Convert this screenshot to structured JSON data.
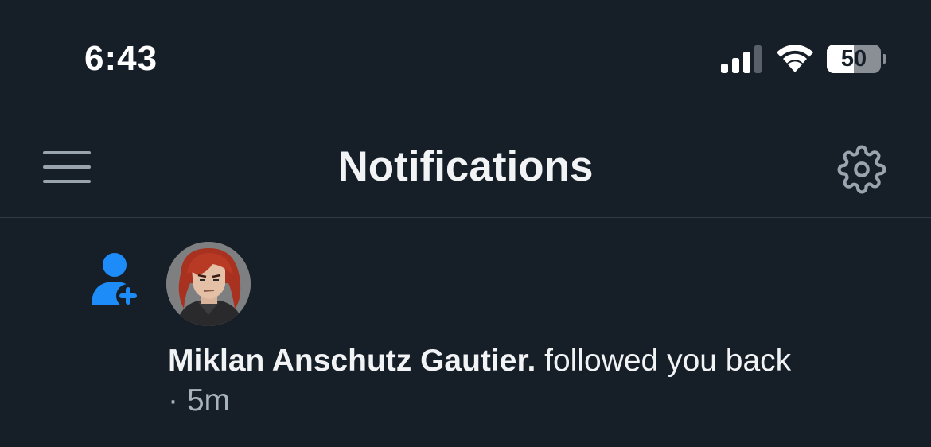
{
  "status_bar": {
    "time": "6:43",
    "battery_level": "50",
    "battery_fraction": 0.5,
    "signal_bars": 3,
    "signal_bars_total": 4
  },
  "header": {
    "title": "Notifications",
    "menu_icon": "hamburger-menu-icon",
    "settings_icon": "gear-icon"
  },
  "notifications": [
    {
      "type_icon": "person-add-icon",
      "avatar": "red-haired-character-avatar",
      "name": "Miklan Anschutz Gautier.",
      "action": " followed you back",
      "time": "· 5m"
    }
  ],
  "colors": {
    "background": "#161e27",
    "accent": "#1d8cf8",
    "text": "#f1f3f5",
    "muted": "#a9b3be",
    "divider": "#2f3a46"
  }
}
